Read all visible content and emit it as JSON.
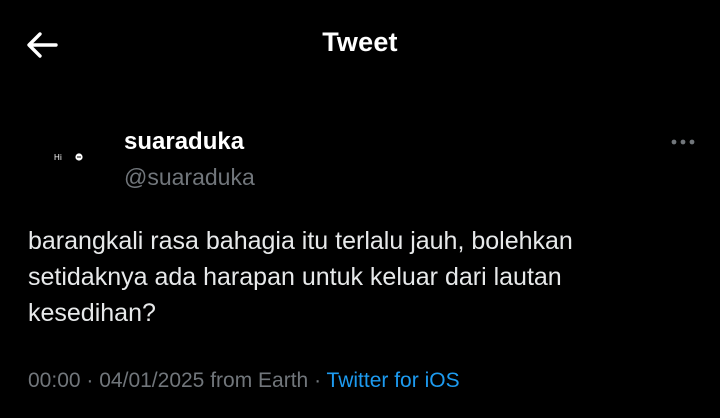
{
  "header": {
    "title": "Tweet",
    "back_icon": "arrow-left-icon"
  },
  "author": {
    "avatar_icon": "avatar-logo-icon",
    "avatar_text": "Hi ●",
    "display_name": "suaraduka",
    "handle": "@suaraduka",
    "more_icon": "more-horizontal-icon"
  },
  "tweet": {
    "text": "barangkali rasa bahagia itu terlalu jauh, bolehkan\nsetidaknya ada harapan untuk keluar dari lautan\nkesedihan?",
    "time": "00:00",
    "separator": "·",
    "date": "04/01/2025",
    "location": "from Earth",
    "source": "Twitter for iOS"
  },
  "colors": {
    "background": "#000000",
    "primary_text": "#e7e9ea",
    "secondary_text": "#71767b",
    "accent": "#1d9bf0"
  }
}
